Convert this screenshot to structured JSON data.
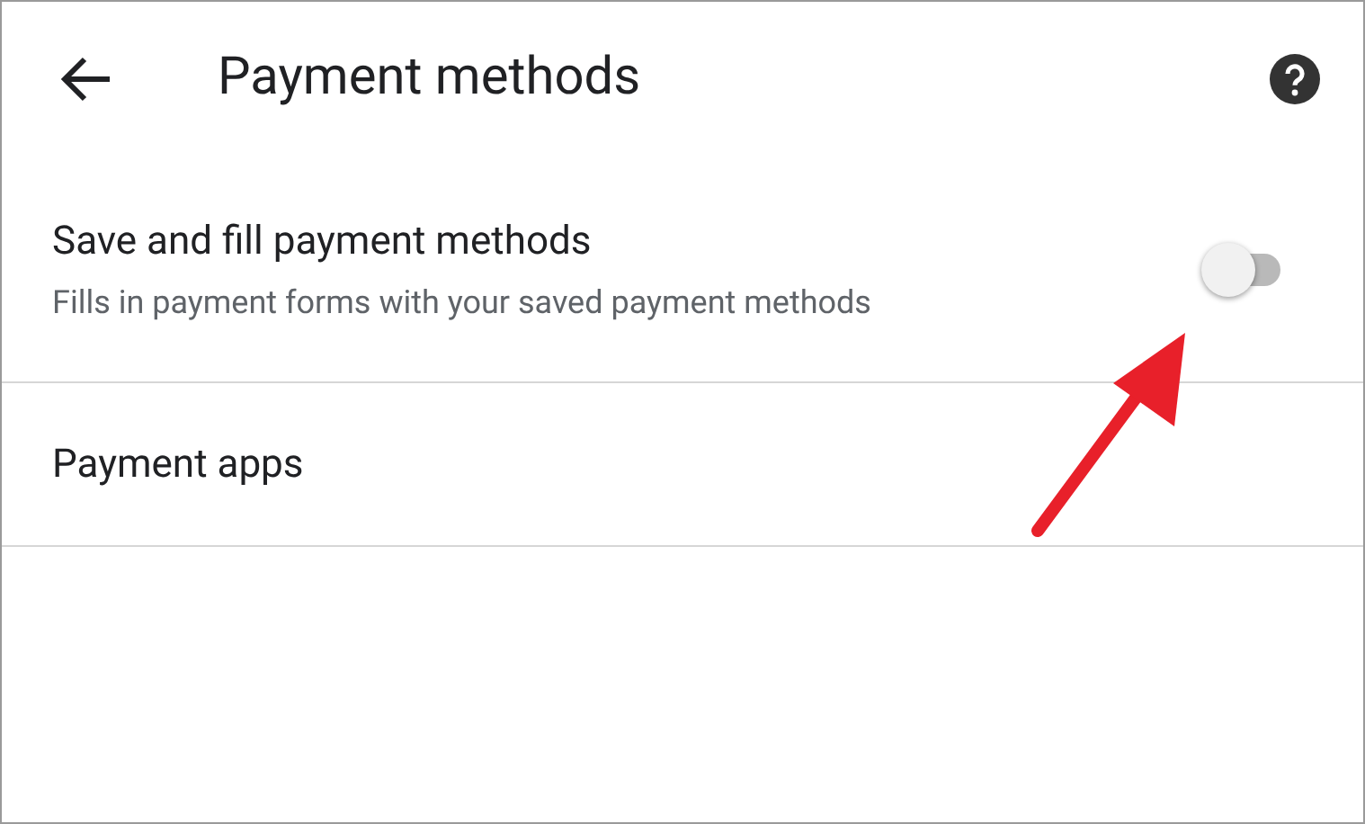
{
  "header": {
    "title": "Payment methods"
  },
  "settings": [
    {
      "kind": "toggle",
      "title": "Save and fill payment methods",
      "subtitle": "Fills in payment forms with your saved payment methods",
      "on": false
    },
    {
      "kind": "link",
      "title": "Payment apps"
    }
  ]
}
